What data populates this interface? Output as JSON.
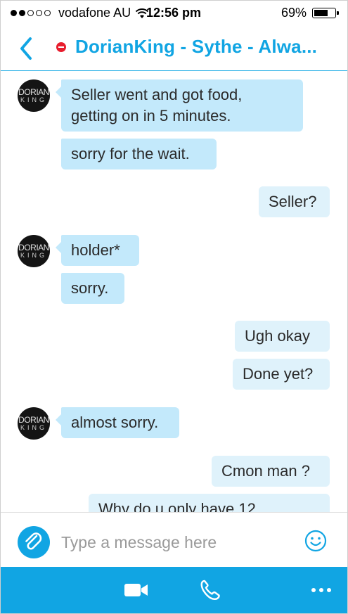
{
  "status_bar": {
    "carrier": "vodafone AU",
    "time": "12:56 pm",
    "battery_percent": "69%",
    "battery_level": 0.69,
    "signal_bars_filled": 2,
    "signal_bars_total": 5
  },
  "header": {
    "title": "DorianKing - Sythe - Alwa...",
    "presence": "do-not-disturb",
    "back_icon": "chevron-left-icon"
  },
  "contact_avatar": {
    "line1": "DORIAN",
    "line2": "KING"
  },
  "messages": [
    {
      "from": "them",
      "text_lines": [
        "Seller went and got food,",
        "getting on in 5 minutes."
      ]
    },
    {
      "from": "them",
      "text_lines": [
        "sorry for the wait."
      ]
    },
    {
      "from": "me",
      "text_lines": [
        "Seller?"
      ]
    },
    {
      "from": "them",
      "text_lines": [
        "holder*"
      ]
    },
    {
      "from": "them",
      "text_lines": [
        "sorry."
      ]
    },
    {
      "from": "me",
      "text_lines": [
        "Ugh okay"
      ]
    },
    {
      "from": "me",
      "text_lines": [
        "Done yet?"
      ]
    },
    {
      "from": "them",
      "text_lines": [
        "almost sorry."
      ]
    },
    {
      "from": "me",
      "text_lines": [
        "Cmon man ?"
      ]
    },
    {
      "from": "me",
      "text_lines": [
        "Why do u only have 12"
      ]
    }
  ],
  "composer": {
    "placeholder": "Type a message here",
    "value": "",
    "attach_icon": "paperclip-icon",
    "emoji_icon": "smiley-icon"
  },
  "bottom_bar": {
    "icons": [
      "video-camera-icon",
      "phone-icon",
      "more-icon"
    ]
  },
  "colors": {
    "accent": "#11a5e3",
    "incoming_bubble": "#c3e9fb",
    "outgoing_bubble": "#dff2fb",
    "presence_dnd": "#e81d2d"
  }
}
